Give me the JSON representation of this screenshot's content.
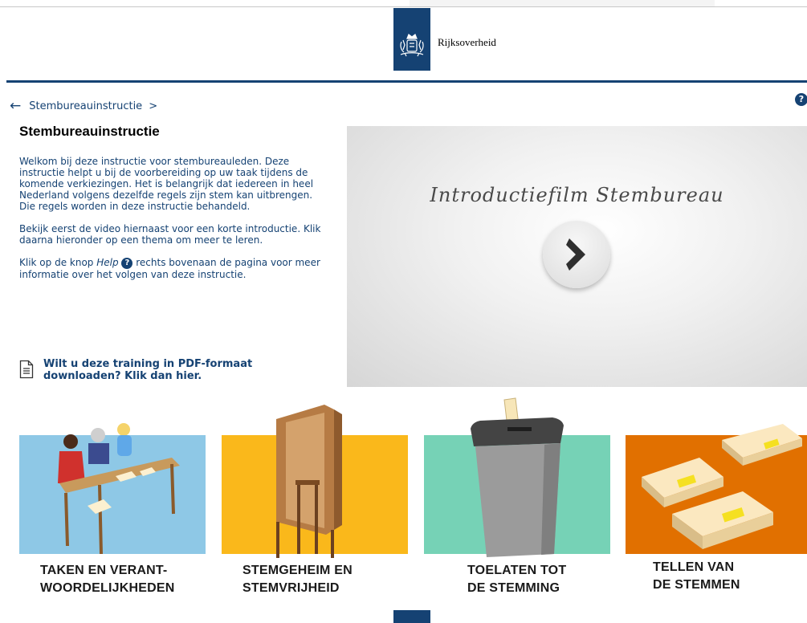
{
  "header": {
    "logo_text": "Rijksoverheid"
  },
  "breadcrumb": {
    "back_icon": "arrow-left-icon",
    "item": "Stembureauinstructie",
    "separator": ">"
  },
  "help": {
    "icon_glyph": "?"
  },
  "page": {
    "title": "Stembureauinstructie",
    "paragraph1": "Welkom bij deze instructie voor stembureauleden. Deze instructie helpt u bij de voorbereiding op uw taak tijdens de komende verkiezingen. Het is belangrijk dat iedereen in heel Nederland volgens dezelfde regels zijn stem kan uitbrengen. Die regels worden in deze instructie behandeld.",
    "paragraph2": "Bekijk eerst de video hiernaast voor een korte introductie. Klik daarna hieronder op een thema om meer te leren.",
    "paragraph3_before": "Klik op de knop",
    "paragraph3_em": "Help",
    "paragraph3_after": "rechts bovenaan de pagina voor meer informatie over het volgen van deze instructie.",
    "pdf_link": "Wilt u deze training in PDF-formaat downloaden? Klik dan hier."
  },
  "video": {
    "title": "Introductiefilm Stembureau",
    "play_icon": "chevron-right-icon"
  },
  "themes": [
    {
      "line1": "TAKEN EN VERANT-",
      "line2": "WOORDELIJKHEDEN",
      "color": "#8ec8e6"
    },
    {
      "line1": "STEMGEHEIM EN",
      "line2": "STEMVRIJHEID",
      "color": "#fab81b"
    },
    {
      "line1": "TOELATEN TOT",
      "line2": "DE STEMMING",
      "color": "#76d2b6"
    },
    {
      "line1": "TELLEN VAN",
      "line2": "DE STEMMEN",
      "color": "#e17000"
    }
  ],
  "colors": {
    "brand": "#154273"
  }
}
